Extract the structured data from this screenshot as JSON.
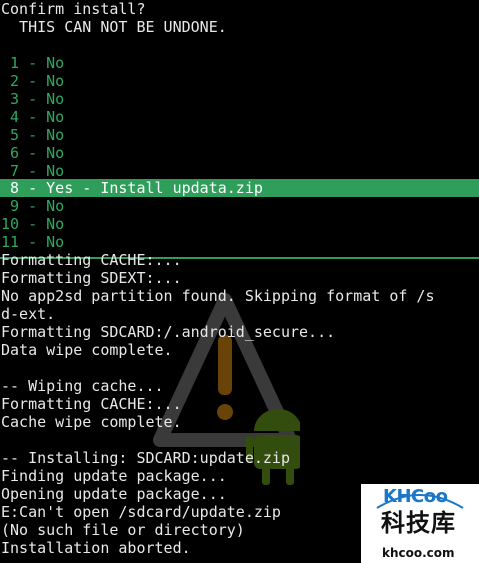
{
  "header": {
    "title": "Confirm install?",
    "warning": "  THIS CAN NOT BE UNDONE."
  },
  "menu": {
    "items": [
      " 1 - No",
      " 2 - No",
      " 3 - No",
      " 4 - No",
      " 5 - No",
      " 6 - No",
      " 7 - No",
      " 8 - Yes - Install updata.zip",
      " 9 - No",
      "10 - No",
      "11 - No"
    ],
    "selected_index": 7
  },
  "log": {
    "lines": [
      "Formatting CACHE:...",
      "Formatting SDEXT:...",
      "No app2sd partition found. Skipping format of /s",
      "d-ext.",
      "Formatting SDCARD:/.android_secure...",
      "Data wipe complete.",
      "",
      "-- Wiping cache...",
      "Formatting CACHE:...",
      "Cache wipe complete.",
      "",
      "-- Installing: SDCARD:update.zip",
      "Finding update package...",
      "Opening update package...",
      "E:Can't open /sdcard/update.zip",
      "(No such file or directory)",
      "Installation aborted."
    ]
  },
  "watermark": {
    "logo_text": "KHCoo",
    "cn_text": "科技库",
    "url_text": "khcoo.com"
  },
  "colors": {
    "background": "#000000",
    "text": "#e8e8e8",
    "menu_text": "#2fa862",
    "highlight": "#2e9e5a",
    "watermark_blue": "#1a77c9"
  }
}
